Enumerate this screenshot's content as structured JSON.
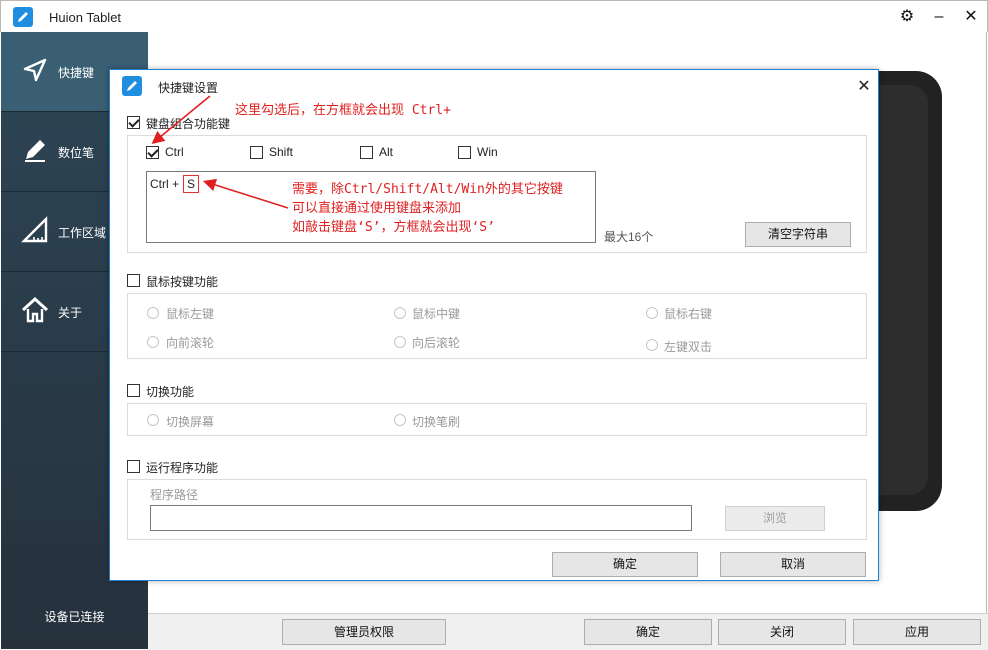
{
  "window": {
    "title": "Huion Tablet",
    "settings_icon": "⚙",
    "minimize_icon": "–",
    "close_icon": "✕"
  },
  "sidebar": {
    "items": [
      {
        "label": "快捷键",
        "icon": "send-arrow-icon"
      },
      {
        "label": "数位笔",
        "icon": "pen-icon"
      },
      {
        "label": "工作区域",
        "icon": "ruler-triangle-icon"
      },
      {
        "label": "关于",
        "icon": "home-icon"
      }
    ],
    "status": "设备已连接"
  },
  "bottombar": {
    "admin": "管理员权限",
    "ok": "确定",
    "close": "关闭",
    "apply": "应用"
  },
  "dialog": {
    "title": "快捷键设置",
    "close_icon": "✕",
    "keyboard_combo": {
      "label": "键盘组合功能键",
      "checked": true,
      "modifiers": [
        {
          "label": "Ctrl",
          "checked": true
        },
        {
          "label": "Shift",
          "checked": false
        },
        {
          "label": "Alt",
          "checked": false
        },
        {
          "label": "Win",
          "checked": false
        }
      ],
      "input_prefix": "Ctrl +",
      "input_key": "S",
      "max_hint": "最大16个",
      "clear_button": "清空字符串"
    },
    "mouse": {
      "label": "鼠标按键功能",
      "checked": false,
      "options": [
        "鼠标左键",
        "鼠标中键",
        "鼠标右键",
        "向前滚轮",
        "向后滚轮",
        "左键双击"
      ]
    },
    "switch": {
      "label": "切换功能",
      "checked": false,
      "options": [
        "切换屏幕",
        "切换笔刷"
      ]
    },
    "run_program": {
      "label": "运行程序功能",
      "checked": false,
      "path_label": "程序路径",
      "path_value": "",
      "browse": "浏览"
    },
    "ok": "确定",
    "cancel": "取消"
  },
  "annotations": {
    "top": "这里勾选后，在方框就会出现 Ctrl+",
    "line1": "需要，除Ctrl/Shift/Alt/Win外的其它按键",
    "line2": "可以直接通过使用键盘来添加",
    "line3": "如敲击键盘‘S’，方框就会出现‘S’",
    "color": "#e02020"
  }
}
